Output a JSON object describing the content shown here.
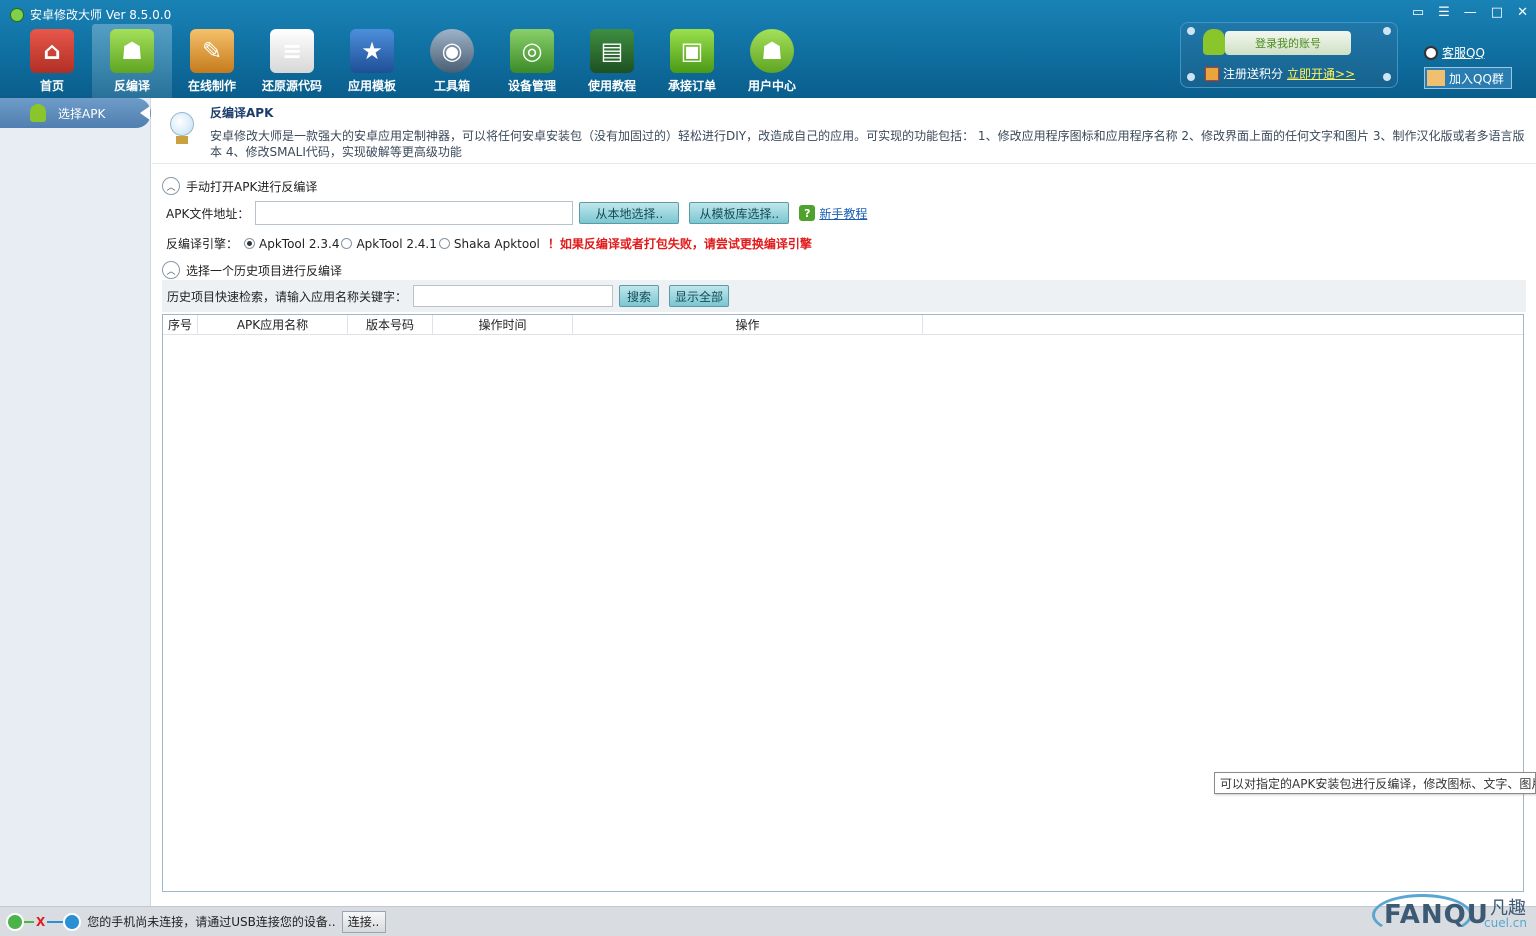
{
  "window": {
    "title": "安卓修改大师 Ver 8.5.0.0"
  },
  "nav": [
    {
      "label": "首页",
      "icon": "house-icon"
    },
    {
      "label": "反编译",
      "icon": "android-icon",
      "active": true
    },
    {
      "label": "在线制作",
      "icon": "toolbox-icon"
    },
    {
      "label": "还原源代码",
      "icon": "document-icon"
    },
    {
      "label": "应用模板",
      "icon": "star-icon"
    },
    {
      "label": "工具箱",
      "icon": "lens-icon"
    },
    {
      "label": "设备管理",
      "icon": "radar-icon"
    },
    {
      "label": "使用教程",
      "icon": "blackboard-icon"
    },
    {
      "label": "承接订单",
      "icon": "shopping-bag-icon"
    },
    {
      "label": "用户中心",
      "icon": "android-icon"
    }
  ],
  "account": {
    "login_label": "登录我的账号",
    "register_text": "注册送积分",
    "register_link": "立即开通>>",
    "qq_service": "客服QQ",
    "qq_group": "加入QQ群"
  },
  "sidebar": {
    "items": [
      {
        "label": "选择APK"
      }
    ]
  },
  "info": {
    "title": "反编译APK",
    "description": "安卓修改大师是一款强大的安卓应用定制神器，可以将任何安卓安装包（没有加固过的）轻松进行DIY，改造成自己的应用。可实现的功能包括： 1、修改应用程序图标和应用程序名称 2、修改界面上面的任何文字和图片 3、制作汉化版或者多语言版本 4、修改SMALI代码，实现破解等更高级功能"
  },
  "manual": {
    "header": "手动打开APK进行反编译",
    "file_label": "APK文件地址：",
    "file_value": "",
    "local_btn": "从本地选择..",
    "template_btn": "从模板库选择..",
    "tutorial_link": "新手教程",
    "engine_label": "反编译引擎：",
    "engines": [
      "ApkTool 2.3.4",
      "ApkTool 2.4.1",
      "Shaka Apktool"
    ],
    "selected_engine": "ApkTool 2.3.4",
    "warning": "！如果反编译或者打包失败，请尝试更换编译引擎"
  },
  "history": {
    "header": "选择一个历史项目进行反编译",
    "search_label": "历史项目快速检索，请输入应用名称关键字：",
    "search_value": "",
    "search_btn": "搜索",
    "show_all_btn": "显示全部",
    "columns": [
      "序号",
      "APK应用名称",
      "版本号码",
      "操作时间",
      "操作"
    ]
  },
  "tooltip": "可以对指定的APK安装包进行反编译，修改图标、文字、图片",
  "status": {
    "message": "您的手机尚未连接，请通过USB连接您的设备..",
    "connect_btn": "连接.."
  },
  "watermark": {
    "brand": "FANQU",
    "cn": "凡趣",
    "url": "cuel.cn"
  },
  "colors": {
    "header": "#0f6fa0",
    "warning": "#e11b1b",
    "accent_btn": "#7ac7d2"
  }
}
